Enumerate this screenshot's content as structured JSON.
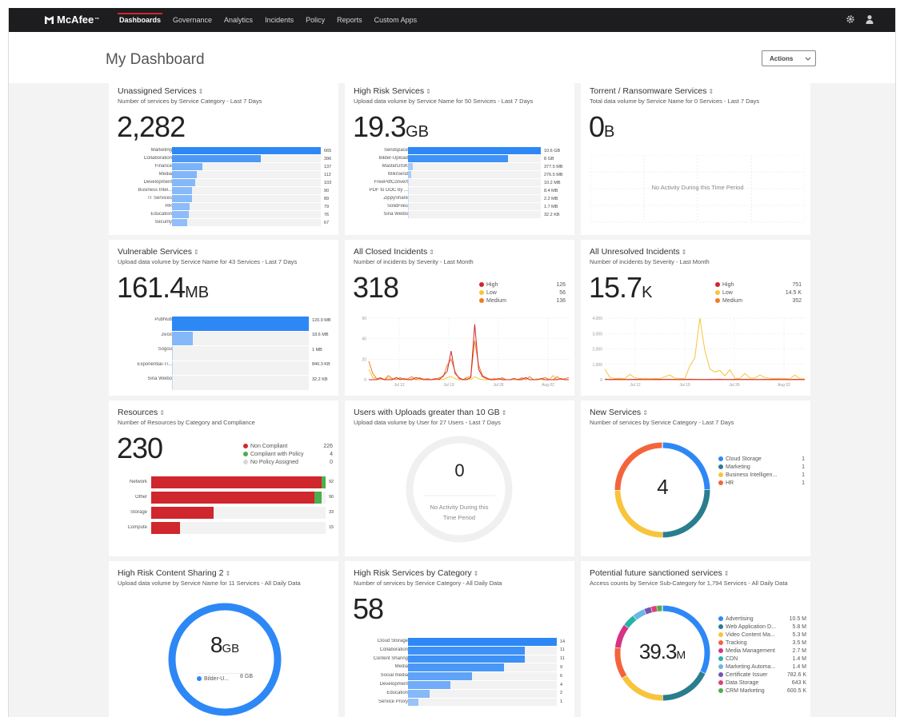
{
  "app": {
    "logo": "McAfee"
  },
  "nav": {
    "items": [
      "Dashboards",
      "Governance",
      "Analytics",
      "Incidents",
      "Policy",
      "Reports",
      "Custom Apps"
    ],
    "active": 0
  },
  "page": {
    "title": "My Dashboard",
    "actions_label": "Actions"
  },
  "colors": {
    "blue": "#2d88f5",
    "red": "#d0262e",
    "orange": "#f47b20",
    "yellow": "#f8c43b",
    "green": "#4cae4c",
    "teal": "#2a7d8f",
    "nav_bg": "#1d1d1f"
  },
  "cards": [
    {
      "title": "Unassigned Services",
      "subtitle": "Number of services by Service Category - Last 7 Days",
      "big": "2,282",
      "unit": "",
      "bars": {
        "labels": [
          "Marketing",
          "Collaboration",
          "Finance",
          "Media",
          "Development",
          "Business Intel...",
          "IT Services",
          "HR",
          "Education",
          "Security"
        ],
        "values": [
          665,
          396,
          137,
          112,
          103,
          90,
          89,
          79,
          76,
          67
        ],
        "display": [
          "665",
          "396",
          "137",
          "112",
          "103",
          "90",
          "89",
          "79",
          "76",
          "67"
        ],
        "max": 665
      }
    },
    {
      "title": "High Risk Services",
      "subtitle": "Upload data volume by Service Name for 50 Services - Last 7 Days",
      "big": "19.3",
      "unit": "GB",
      "bars": {
        "labels": [
          "Sendspace",
          "Bilder-Upload",
          "MasterDISK",
          "WikiSend",
          "FreePdfConvert",
          "PDF to DOC by ...",
          "ZippyShare",
          "SolidFiles",
          "Sina Weibo"
        ],
        "values": [
          10.6,
          8,
          0.3775,
          0.2765,
          0.0102,
          0.0084,
          0.0022,
          0.0017,
          0.0003
        ],
        "display": [
          "10.6 GB",
          "8 GB",
          "377.5 MB",
          "276.5 MB",
          "10.2 MB",
          "8.4 MB",
          "2.2 MB",
          "1.7 MB",
          "32.2 KB"
        ],
        "max": 10.6
      }
    },
    {
      "title": "Torrent / Ransomware Services",
      "subtitle": "Total data volume by Service Name for 0 Services - Last 7 Days",
      "big": "0",
      "unit": "B",
      "no_activity": "No Activity During this Time Period"
    },
    {
      "title": "Vulnerable Services",
      "subtitle": "Upload data volume by Service Name for 43 Services - Last 7 Days",
      "big": "161.4",
      "unit": "MB",
      "bars": {
        "labels": [
          "PubNub",
          "Jivox",
          "Sogou",
          "Exponential-Tr...",
          "Sina Weibo"
        ],
        "values": [
          120.9,
          18.6,
          1,
          0.84,
          0.032
        ],
        "display": [
          "120.9 MB",
          "18.6 MB",
          "1 MB",
          "840.3 KB",
          "32.2 KB"
        ],
        "max": 120.9
      }
    },
    {
      "title": "All Closed Incidents",
      "subtitle": "Number of incidents by Severity - Last Month",
      "big": "318",
      "unit": "",
      "legend": [
        {
          "label": "High",
          "value": "126",
          "color": "#d0262e"
        },
        {
          "label": "Low",
          "value": "56",
          "color": "#f8c43b"
        },
        {
          "label": "Medium",
          "value": "136",
          "color": "#f47b20"
        }
      ]
    },
    {
      "title": "All Unresolved Incidents",
      "subtitle": "Number of incidents by Severity - Last Month",
      "big": "15.7",
      "unit": "K",
      "legend": [
        {
          "label": "High",
          "value": "751",
          "color": "#d0262e"
        },
        {
          "label": "Low",
          "value": "14.5 K",
          "color": "#f8c43b"
        },
        {
          "label": "Medium",
          "value": "352",
          "color": "#f47b20"
        }
      ]
    },
    {
      "title": "Resources",
      "subtitle": "Number of Resources by Category and Compliance",
      "big": "230",
      "unit": "",
      "legend": [
        {
          "label": "Non Compliant",
          "value": "226",
          "color": "#d0262e"
        },
        {
          "label": "Compliant with Policy",
          "value": "4",
          "color": "#4cae4c"
        },
        {
          "label": "No Policy Assigned",
          "value": "0",
          "color": "#d8d8d8"
        }
      ],
      "bars": {
        "labels": [
          "Network",
          "Other",
          "Storage",
          "Compute"
        ],
        "red": [
          90,
          86,
          33,
          15
        ],
        "green": [
          2,
          4,
          0,
          0
        ],
        "display": [
          "92",
          "90",
          "33",
          "15"
        ],
        "max": 92
      }
    },
    {
      "title": "Users with Uploads greater than 10 GB",
      "subtitle": "Upload data volume by User for 27 Users - Last 7 Days",
      "big": "0",
      "unit": "",
      "no_activity_1": "No Activity During this",
      "no_activity_2": "Time Period"
    },
    {
      "title": "New Services",
      "subtitle": "Number of services by Service Category - Last 7 Days",
      "big": "4",
      "unit": "",
      "legend": [
        {
          "label": "Cloud Storage",
          "value": "1",
          "color": "#2d88f5"
        },
        {
          "label": "Marketing",
          "value": "1",
          "color": "#2a7d8f"
        },
        {
          "label": "Business Intelligen...",
          "value": "1",
          "color": "#f8c43b"
        },
        {
          "label": "HR",
          "value": "1",
          "color": "#f4643c"
        }
      ]
    },
    {
      "title": "High Risk Content Sharing 2",
      "subtitle": "Upload data volume by Service Name for 11 Services - All Daily Data",
      "big": "8",
      "unit": "GB",
      "legend": [
        {
          "label": "Bilder-U...",
          "value": "8 GB",
          "color": "#2d88f5"
        }
      ]
    },
    {
      "title": "High Risk Services by Category",
      "subtitle": "Number of services by Service Category - All Daily Data",
      "big": "58",
      "unit": "",
      "bars": {
        "labels": [
          "Cloud Storage",
          "Collaboration",
          "Content Sharing",
          "Media",
          "Social media",
          "Development",
          "Education",
          "Service Proxy"
        ],
        "values": [
          14,
          11,
          11,
          9,
          6,
          4,
          2,
          1
        ],
        "display": [
          "14",
          "11",
          "11",
          "9",
          "6",
          "4",
          "2",
          "1"
        ],
        "max": 14
      }
    },
    {
      "title": "Potential future sanctioned services",
      "subtitle": "Access counts by Service Sub-Category for 1,794 Services - All Daily Data",
      "big": "39.3",
      "unit": "M",
      "legend": [
        {
          "label": "Advertising",
          "value": "10.5 M",
          "color": "#2d88f5"
        },
        {
          "label": "Web Application D...",
          "value": "5.8 M",
          "color": "#2a7d8f"
        },
        {
          "label": "Video Content Ma...",
          "value": "5.3 M",
          "color": "#f8c43b"
        },
        {
          "label": "Tracking",
          "value": "3.5 M",
          "color": "#f4643c"
        },
        {
          "label": "Media Management",
          "value": "2.7 M",
          "color": "#d63384"
        },
        {
          "label": "CDN",
          "value": "1.4 M",
          "color": "#27b3a7"
        },
        {
          "label": "Marketing Automa...",
          "value": "1.4 M",
          "color": "#69b7e6"
        },
        {
          "label": "Certificate Issuer",
          "value": "782.6 K",
          "color": "#7952b3"
        },
        {
          "label": "Data Storage",
          "value": "643 K",
          "color": "#e0407a"
        },
        {
          "label": "CRM Marketing",
          "value": "600.5 K",
          "color": "#4cae4c"
        }
      ]
    }
  ],
  "chart_data": [
    {
      "type": "line",
      "title": "All Closed Incidents",
      "x": [
        "Jul 12",
        "Jul 19",
        "Jul 26",
        "Aug 02"
      ],
      "ylim": [
        0,
        60
      ],
      "yticks": [
        0,
        20,
        40,
        60
      ],
      "series": [
        {
          "name": "High",
          "values": [
            0,
            0,
            0,
            0,
            0,
            0,
            0,
            0,
            0,
            0,
            0,
            0,
            0,
            0,
            0,
            0,
            0,
            0,
            0,
            0,
            0,
            0,
            0,
            0,
            0,
            0,
            0,
            0,
            0,
            0,
            0,
            0,
            0,
            0,
            0,
            0,
            0,
            0,
            0,
            0,
            0,
            0,
            0,
            0,
            0,
            0,
            0,
            0,
            0,
            0,
            0,
            0
          ]
        },
        {
          "name": "Low",
          "values": [
            0,
            0,
            0,
            0,
            0,
            0,
            0,
            0,
            0,
            0,
            0,
            0,
            0,
            0,
            0,
            0,
            0,
            0,
            0,
            0,
            0,
            0,
            0,
            0,
            0,
            0,
            0,
            0,
            0,
            0,
            0,
            0,
            0,
            0,
            0,
            0,
            0,
            0,
            0,
            0,
            0,
            0,
            0,
            0,
            0,
            0,
            0,
            0,
            0,
            0,
            0,
            0
          ]
        },
        {
          "name": "Medium",
          "values": [
            0,
            0,
            0,
            0,
            0,
            0,
            0,
            0,
            0,
            0,
            0,
            0,
            0,
            0,
            0,
            0,
            0,
            0,
            0,
            0,
            0,
            0,
            0,
            0,
            0,
            0,
            0,
            0,
            0,
            0,
            0,
            0,
            0,
            0,
            0,
            0,
            0,
            0,
            0,
            0,
            0,
            0,
            0,
            0,
            0,
            0,
            0,
            0,
            0,
            0,
            0,
            0
          ]
        }
      ]
    },
    {
      "type": "line",
      "title": "All Unresolved Incidents",
      "x": [
        "Jul 12",
        "Jul 19",
        "Jul 26",
        "Aug 02"
      ],
      "ylim": [
        0,
        4000
      ],
      "yticks": [
        0,
        1000,
        2000,
        3000,
        4000
      ]
    }
  ],
  "lines": {
    "closed": {
      "high": [
        0,
        0,
        0,
        1,
        0,
        0,
        0,
        2,
        0,
        1,
        0,
        0,
        2,
        1,
        0,
        0,
        0,
        1,
        0,
        4,
        8,
        28,
        6,
        2,
        0,
        0,
        2,
        54,
        10,
        3,
        1,
        0,
        0,
        1,
        0,
        0,
        0,
        1,
        0,
        0,
        2,
        0,
        0,
        0,
        1,
        0,
        0,
        0,
        0,
        1,
        0,
        0
      ],
      "medium": [
        18,
        6,
        1,
        2,
        0,
        4,
        1,
        0,
        2,
        0,
        1,
        3,
        0,
        2,
        0,
        1,
        0,
        0,
        2,
        3,
        14,
        20,
        8,
        1,
        0,
        2,
        3,
        38,
        14,
        4,
        2,
        0,
        1,
        0,
        2,
        0,
        0,
        1,
        0,
        2,
        0,
        3,
        0,
        0,
        1,
        2,
        0,
        0,
        3,
        0,
        1,
        2
      ],
      "low": [
        10,
        2,
        1,
        1,
        0,
        2,
        0,
        2,
        1,
        0,
        0,
        1,
        0,
        0,
        1,
        0,
        0,
        0,
        1,
        0,
        2,
        3,
        1,
        0,
        0,
        1,
        0,
        3,
        1,
        0,
        0,
        1,
        0,
        0,
        1,
        0,
        0,
        0,
        0,
        1,
        2,
        0,
        0,
        1,
        0,
        0,
        0,
        4,
        0,
        1,
        0,
        0
      ]
    },
    "unresolved": {
      "high": [
        10,
        5,
        8,
        6,
        5,
        7,
        8,
        6,
        5,
        4,
        6,
        8,
        5,
        6,
        7,
        5,
        8,
        6,
        5,
        7,
        5,
        8,
        6,
        5,
        7,
        5,
        8,
        6,
        5,
        4,
        6,
        5,
        7,
        6,
        5,
        4,
        6,
        5,
        7,
        6,
        5
      ],
      "medium": [
        40,
        20,
        25,
        30,
        15,
        20,
        25,
        30,
        20,
        15,
        25,
        20,
        30,
        25,
        20,
        15,
        20,
        30,
        25,
        20,
        15,
        20,
        25,
        30,
        20,
        15,
        25,
        20,
        30,
        25,
        20,
        15,
        25,
        20,
        30,
        25,
        20,
        15,
        25,
        20,
        15
      ],
      "low": [
        700,
        150,
        80,
        100,
        60,
        350,
        120,
        80,
        100,
        60,
        80,
        70,
        200,
        300,
        100,
        80,
        60,
        900,
        1400,
        4000,
        1900,
        700,
        500,
        600,
        250,
        650,
        100,
        80,
        400,
        120,
        100,
        300,
        150,
        90,
        60,
        100,
        80,
        50,
        300,
        60,
        40
      ]
    }
  },
  "donuts": {
    "new_services": [
      1,
      1,
      1,
      1
    ],
    "content_sharing": [
      8
    ],
    "potential": [
      10.5,
      5.8,
      5.3,
      3.5,
      2.7,
      1.4,
      1.4,
      0.7826,
      0.643,
      0.6005
    ]
  }
}
